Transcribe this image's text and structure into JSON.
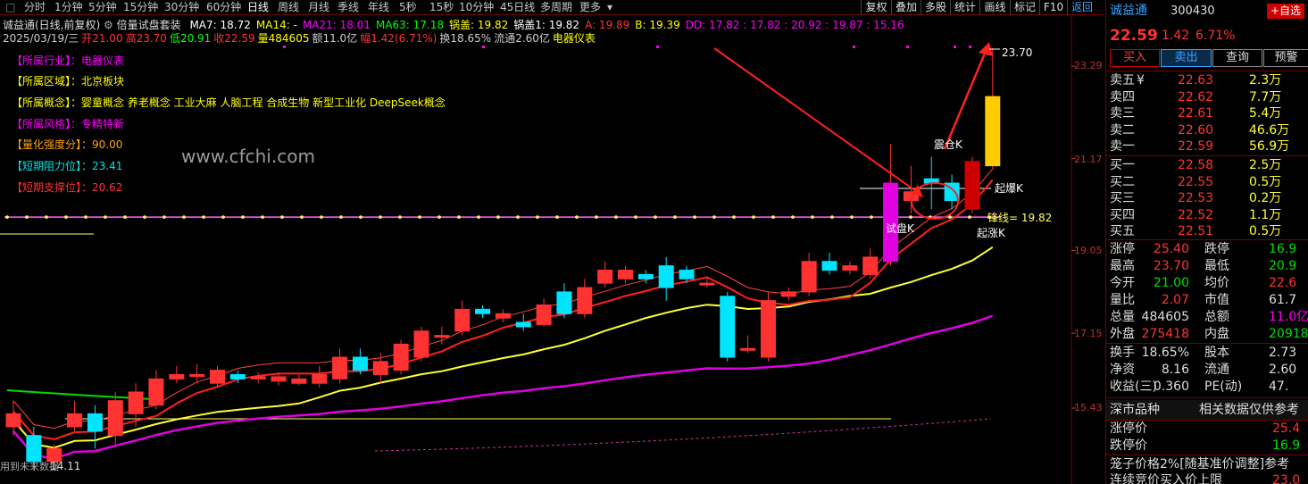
{
  "periods": [
    "分时",
    "1分钟",
    "5分钟",
    "15分钟",
    "30分钟",
    "60分钟",
    "日线",
    "周线",
    "月线",
    "季线",
    "年线",
    "5秒",
    "15秒",
    "10分钟",
    "45日线",
    "多周期",
    "更多"
  ],
  "active_period": "日线",
  "toolbar_buttons": [
    "复权",
    "叠加",
    "多股",
    "统计",
    "画线",
    "标记",
    "F10",
    "返回"
  ],
  "chart": {
    "title": "诚益通(日线,前复权)",
    "indicator_name": "倍量试盘套装",
    "ma": [
      {
        "text": "MA7: 18.72",
        "color": "#ffffff"
      },
      {
        "text": "MA14: -",
        "color": "#ffff00"
      },
      {
        "text": "MA21: 18.01",
        "color": "#ff00ff"
      },
      {
        "text": "MA63: 17.18",
        "color": "#00ff00"
      },
      {
        "text": "锅盖: 19.82",
        "color": "#ffff00"
      },
      {
        "text": "锅盖1: 19.82",
        "color": "#ffffff"
      },
      {
        "text": "A: 19.89",
        "color": "#ff3333"
      },
      {
        "text": "B: 19.39",
        "color": "#ffff00"
      },
      {
        "text": "DD: 17.82 : 17.82 : 20.92 : 19.87 : 15.16",
        "color": "#ff00ff"
      }
    ],
    "date_line": [
      {
        "text": "2025/03/19/三",
        "color": "#cccccc"
      },
      {
        "text": "开21.00",
        "color": "#ff3333"
      },
      {
        "text": "高23.70",
        "color": "#ff3333"
      },
      {
        "text": "低20.91",
        "color": "#00ff00"
      },
      {
        "text": "收22.59",
        "color": "#ff3333"
      },
      {
        "text": "量484605",
        "color": "#ffff00"
      },
      {
        "text": "额11.0亿",
        "color": "#cccccc"
      },
      {
        "text": "幅1.42(6.71%)",
        "color": "#ff3333"
      },
      {
        "text": "换18.65%",
        "color": "#cccccc"
      },
      {
        "text": "流通2.60亿",
        "color": "#cccccc"
      },
      {
        "text": "电器仪表",
        "color": "#ffff00"
      }
    ],
    "info_lines": [
      {
        "label": "【所属行业】：",
        "value": "电器仪表",
        "label_color": "#ff00ff",
        "value_color": "#ff00ff"
      },
      {
        "label": "【所属区域】：",
        "value": "北京板块",
        "label_color": "#ffff00",
        "value_color": "#ffff00"
      },
      {
        "label": "【所属概念】：",
        "value": "婴童概念 养老概念 工业大麻 人脑工程 合成生物 新型工业化 DeepSeek概念",
        "label_color": "#ffff00",
        "value_color": "#ffff00"
      },
      {
        "label": "【所属风格】：",
        "value": "专精特新",
        "label_color": "#ff00ff",
        "value_color": "#ff00ff"
      },
      {
        "label": "【量化强度分】：",
        "value": "90.00",
        "label_color": "#ffa500",
        "value_color": "#ffa500"
      },
      {
        "label": "【短期阻力位】：",
        "value": "23.41",
        "label_color": "#00e5e5",
        "value_color": "#00e5e5"
      },
      {
        "label": "【短期支撑位】：",
        "value": "20.62",
        "label_color": "#ff3333",
        "value_color": "#ff3333"
      }
    ],
    "watermark": "www.cfchi.com",
    "y_axis_labels": [
      "23.29",
      "21.17",
      "19.05",
      "17.15",
      "15.43"
    ],
    "annotations": {
      "high_label": "23.70",
      "zhencang": "震仓K",
      "qibao": "起爆K",
      "shipan": "试盘K",
      "qizhang": "起涨K",
      "fengxian": "锋线= 19.82",
      "low_label": "14.11"
    },
    "bottom_text": "用到未来数据"
  },
  "chart_data": {
    "type": "candlestick",
    "series": [
      {
        "open": 15.0,
        "close": 15.3,
        "high": 15.6,
        "low": 14.8
      },
      {
        "open": 14.8,
        "close": 14.2,
        "high": 15.0,
        "low": 14.0
      },
      {
        "open": 14.2,
        "close": 14.5,
        "high": 14.6,
        "low": 14.11
      },
      {
        "open": 15.0,
        "close": 15.3,
        "high": 15.6,
        "low": 14.9
      },
      {
        "open": 15.3,
        "close": 14.9,
        "high": 15.5,
        "low": 14.5
      },
      {
        "open": 14.8,
        "close": 15.6,
        "high": 15.8,
        "low": 14.6
      },
      {
        "open": 15.3,
        "close": 15.8,
        "high": 16.0,
        "low": 15.0
      },
      {
        "open": 15.5,
        "close": 16.1,
        "high": 16.3,
        "low": 15.4
      },
      {
        "open": 16.1,
        "close": 16.2,
        "high": 16.4,
        "low": 16.0
      },
      {
        "open": 16.2,
        "close": 16.2,
        "high": 16.45,
        "low": 16.0
      },
      {
        "open": 16.0,
        "close": 16.3,
        "high": 16.4,
        "low": 15.9
      },
      {
        "open": 16.2,
        "close": 16.1,
        "high": 16.3,
        "low": 16.0
      },
      {
        "open": 16.1,
        "close": 16.15,
        "high": 16.25,
        "low": 16.0
      },
      {
        "open": 16.05,
        "close": 16.15,
        "high": 16.25,
        "low": 15.95
      },
      {
        "open": 16.0,
        "close": 16.1,
        "high": 16.2,
        "low": 15.95
      },
      {
        "open": 16.0,
        "close": 16.2,
        "high": 16.4,
        "low": 15.9
      },
      {
        "open": 16.1,
        "close": 16.6,
        "high": 16.8,
        "low": 16.0
      },
      {
        "open": 16.6,
        "close": 16.3,
        "high": 16.8,
        "low": 16.2
      },
      {
        "open": 16.2,
        "close": 16.5,
        "high": 16.7,
        "low": 16.0
      },
      {
        "open": 16.3,
        "close": 16.9,
        "high": 17.0,
        "low": 16.2
      },
      {
        "open": 16.6,
        "close": 17.2,
        "high": 17.3,
        "low": 16.5
      },
      {
        "open": 17.1,
        "close": 17.1,
        "high": 17.3,
        "low": 16.9
      },
      {
        "open": 17.2,
        "close": 17.7,
        "high": 17.9,
        "low": 17.1
      },
      {
        "open": 17.7,
        "close": 17.6,
        "high": 17.8,
        "low": 17.5
      },
      {
        "open": 17.5,
        "close": 17.6,
        "high": 17.7,
        "low": 17.4
      },
      {
        "open": 17.4,
        "close": 17.3,
        "high": 17.6,
        "low": 17.2
      },
      {
        "open": 17.35,
        "close": 17.8,
        "high": 17.95,
        "low": 17.3
      },
      {
        "open": 18.1,
        "close": 17.6,
        "high": 18.3,
        "low": 17.5
      },
      {
        "open": 17.6,
        "close": 18.2,
        "high": 18.4,
        "low": 17.5
      },
      {
        "open": 18.3,
        "close": 18.6,
        "high": 18.8,
        "low": 18.2
      },
      {
        "open": 18.4,
        "close": 18.6,
        "high": 18.7,
        "low": 18.3
      },
      {
        "open": 18.5,
        "close": 18.4,
        "high": 18.6,
        "low": 18.3
      },
      {
        "open": 18.7,
        "close": 18.2,
        "high": 18.9,
        "low": 17.9
      },
      {
        "open": 18.6,
        "close": 18.4,
        "high": 18.7,
        "low": 18.3
      },
      {
        "open": 18.3,
        "close": 18.3,
        "high": 18.45,
        "low": 18.2
      },
      {
        "open": 18.0,
        "close": 16.6,
        "high": 18.1,
        "low": 16.5
      },
      {
        "open": 16.8,
        "close": 16.8,
        "high": 17.1,
        "low": 16.7
      },
      {
        "open": 16.6,
        "close": 17.9,
        "high": 18.1,
        "low": 16.5
      },
      {
        "open": 18.0,
        "close": 18.1,
        "high": 18.2,
        "low": 17.9
      },
      {
        "open": 18.1,
        "close": 18.8,
        "high": 19.0,
        "low": 18.0
      },
      {
        "open": 18.8,
        "close": 18.6,
        "high": 19.0,
        "low": 18.5
      },
      {
        "open": 18.6,
        "close": 18.7,
        "high": 18.8,
        "low": 18.5
      },
      {
        "open": 18.5,
        "close": 18.9,
        "high": 19.1,
        "low": 18.4
      },
      {
        "open": 18.8,
        "close": 20.6,
        "high": 21.5,
        "low": 18.7
      },
      {
        "open": 20.2,
        "close": 20.4,
        "high": 21.0,
        "low": 19.9
      },
      {
        "open": 20.7,
        "close": 20.6,
        "high": 21.2,
        "low": 20.0
      },
      {
        "open": 20.6,
        "close": 20.2,
        "high": 20.8,
        "low": 20.0
      },
      {
        "open": 20.0,
        "close": 21.1,
        "high": 21.2,
        "low": 19.9
      },
      {
        "open": 21.0,
        "close": 22.59,
        "high": 23.7,
        "low": 20.91
      }
    ]
  },
  "right_panel": {
    "name": "诚益通",
    "code": "300430",
    "add_watch": "+自选",
    "price": "22.59",
    "change": "1.42",
    "change_pct": "6.71%",
    "buttons": [
      "买入",
      "卖出",
      "查询",
      "预警"
    ],
    "asks": [
      {
        "label": "卖五",
        "extra": "¥",
        "price": "22.63",
        "vol": "2.3万"
      },
      {
        "label": "卖四",
        "extra": "",
        "price": "22.62",
        "vol": "7.7万"
      },
      {
        "label": "卖三",
        "extra": "",
        "price": "22.61",
        "vol": "5.4万"
      },
      {
        "label": "卖二",
        "extra": "",
        "price": "22.60",
        "vol": "46.6万"
      },
      {
        "label": "卖一",
        "extra": "",
        "price": "22.59",
        "vol": "56.9万"
      }
    ],
    "bids": [
      {
        "label": "买一",
        "price": "22.58",
        "vol": "2.5万"
      },
      {
        "label": "买二",
        "price": "22.55",
        "vol": "0.5万"
      },
      {
        "label": "买三",
        "price": "22.53",
        "vol": "0.2万"
      },
      {
        "label": "买四",
        "price": "22.52",
        "vol": "1.1万"
      },
      {
        "label": "买五",
        "price": "22.51",
        "vol": "0.5万"
      }
    ],
    "stats": [
      {
        "l1": "涨停",
        "v1": "25.40",
        "c1": "#ff3333",
        "l2": "跌停",
        "v2": "16.9",
        "c2": "#00e000"
      },
      {
        "l1": "最高",
        "v1": "23.70",
        "c1": "#ff3333",
        "l2": "最低",
        "v2": "20.9",
        "c2": "#00e000"
      },
      {
        "l1": "今开",
        "v1": "21.00",
        "c1": "#00e000",
        "l2": "均价",
        "v2": "22.6",
        "c2": "#ff3333"
      },
      {
        "l1": "量比",
        "v1": "2.07",
        "c1": "#ff3333",
        "l2": "市值",
        "v2": "61.7",
        "c2": "#dddddd"
      },
      {
        "l1": "总量",
        "v1": "484605",
        "c1": "#dddddd",
        "l2": "总额",
        "v2": "11.0亿",
        "c2": "#ff00ff"
      },
      {
        "l1": "外盘",
        "v1": "275418",
        "c1": "#ff3333",
        "l2": "内盘",
        "v2": "20918",
        "c2": "#00e000"
      }
    ],
    "stats2": [
      {
        "l1": "换手",
        "v1": "18.65%",
        "l2": "股本",
        "v2": "2.73"
      },
      {
        "l1": "净资",
        "v1": "8.16",
        "l2": "流通",
        "v2": "2.60"
      },
      {
        "l1": "收益(三)",
        "v1": "0.360",
        "l2": "PE(动)",
        "v2": "47."
      }
    ],
    "market_title": "深市品种",
    "market_note": "相关数据仅供参考",
    "limits": [
      {
        "label": "涨停价",
        "value": "25.4",
        "color": "#ff3333"
      },
      {
        "label": "跌停价",
        "value": "16.9",
        "color": "#00e000"
      }
    ],
    "bottom1": "笼子价格2%[随基准价调整]参考",
    "bottom2_label": "连续竞价买入价上限",
    "bottom2_value": "23.0"
  }
}
